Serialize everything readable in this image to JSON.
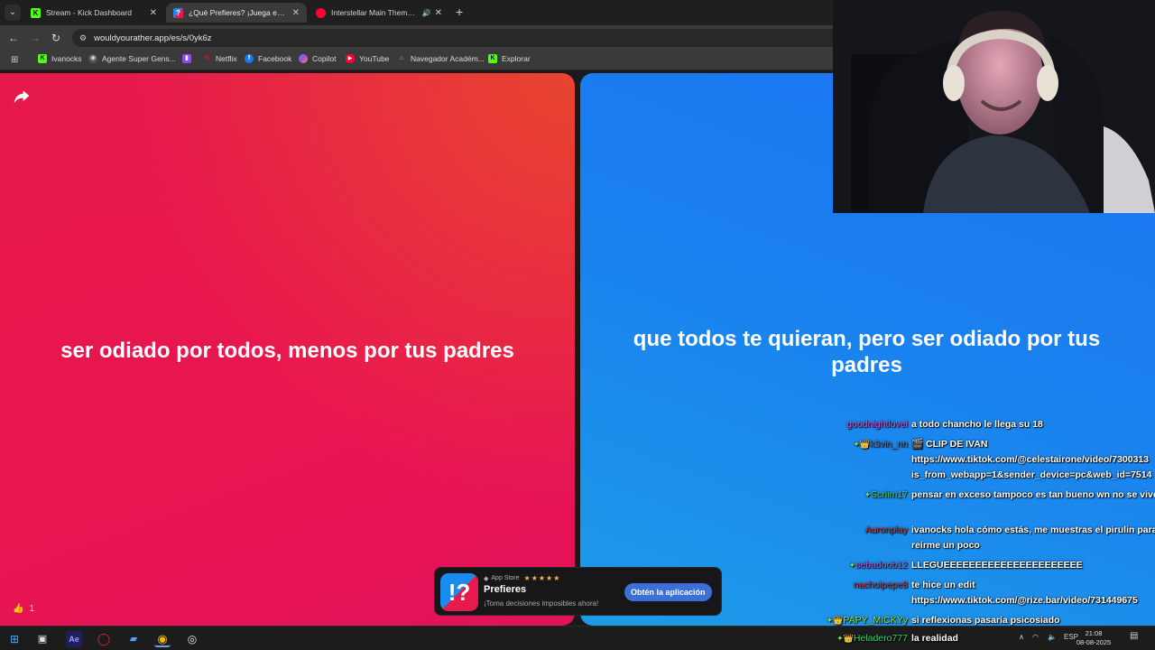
{
  "browser": {
    "tabs": [
      {
        "label": "Stream - Kick Dashboard",
        "favicon": "kick-icon",
        "color": "#53fc18",
        "active": false
      },
      {
        "label": "¿Qué Prefieres? ¡Juega en línea!",
        "favicon": "prefieres-icon",
        "color": "#1a8cf0",
        "active": true
      },
      {
        "label": "Interstellar Main Theme - E",
        "favicon": "youtube-icon",
        "color": "#ff0033",
        "active": false
      }
    ],
    "new_tab": "+",
    "url": "wouldyourather.app/es/s/0yk6z",
    "bookmarks": [
      {
        "label": "Ivanocks",
        "icon": "kick-icon"
      },
      {
        "label": "Agente Super Gens...",
        "icon": "agent-icon"
      },
      {
        "label": "",
        "icon": "twitch-icon"
      },
      {
        "label": "Netflix",
        "icon": "netflix-icon"
      },
      {
        "label": "Facebook",
        "icon": "facebook-icon"
      },
      {
        "label": "Copilot",
        "icon": "copilot-icon"
      },
      {
        "label": "YouTube",
        "icon": "youtube-icon"
      },
      {
        "label": "Navegador Académ...",
        "icon": "scholar-icon"
      },
      {
        "label": "Explorar",
        "icon": "kick-icon"
      }
    ]
  },
  "game": {
    "option_red": "ser odiado por todos, menos por tus padres",
    "option_blue": "que todos te quieran, pero ser odiado por tus padres",
    "likes_count": "1",
    "red_color": "#e8174f",
    "blue_color": "#1a7ff0"
  },
  "app_banner": {
    "store": "App Store",
    "stars": "★★★★★",
    "name": "Prefieres",
    "tagline": "¡Toma decisiones imposibles ahora!",
    "cta": "Obtén la aplicación"
  },
  "chat": {
    "messages": [
      {
        "user": "goodnightlovel",
        "color": "#c35bd8",
        "badges": "",
        "text": "a todo chancho le llega su 18"
      },
      {
        "user": "k3vin_nn",
        "color": "#6a6a9a",
        "badges": "✦👑",
        "text": "🎬 CLIP DE IVAN https://www.tiktok.com/@celestairone/video/7300313 is_from_webapp=1&sender_device=pc&web_id=7514"
      },
      {
        "user": "Scriim17",
        "color": "#4fc96e",
        "badges": "✦",
        "text": "pensar en exceso tampoco es tan bueno wn no se vive"
      },
      {
        "user": "Auronplay",
        "color": "#c8332d",
        "badges": "",
        "text": "ivanocks hola cómo estás, me muestras el pirulin para reírme un poco"
      },
      {
        "user": "sebadoob12",
        "color": "#b257d6",
        "badges": "✦",
        "text": "LLEGUEEEEEEEEEEEEEEEEEEEEEE"
      },
      {
        "user": "nachoipepe8",
        "color": "#cc3355",
        "badges": "",
        "text": "te hice un edit https://www.tiktok.com/@rize.bar/video/731449675"
      },
      {
        "user": "PAPY_MICKYy",
        "color": "#9be34a",
        "badges": "✦👑",
        "text": "si reflexionas pasaría psicosiado"
      },
      {
        "user": "Heladero777",
        "color": "#3fd66a",
        "badges": "✦👑",
        "text": "la realidad"
      }
    ]
  },
  "taskbar": {
    "language": "ESP",
    "time": "21:08",
    "date": "08-08-2025"
  }
}
